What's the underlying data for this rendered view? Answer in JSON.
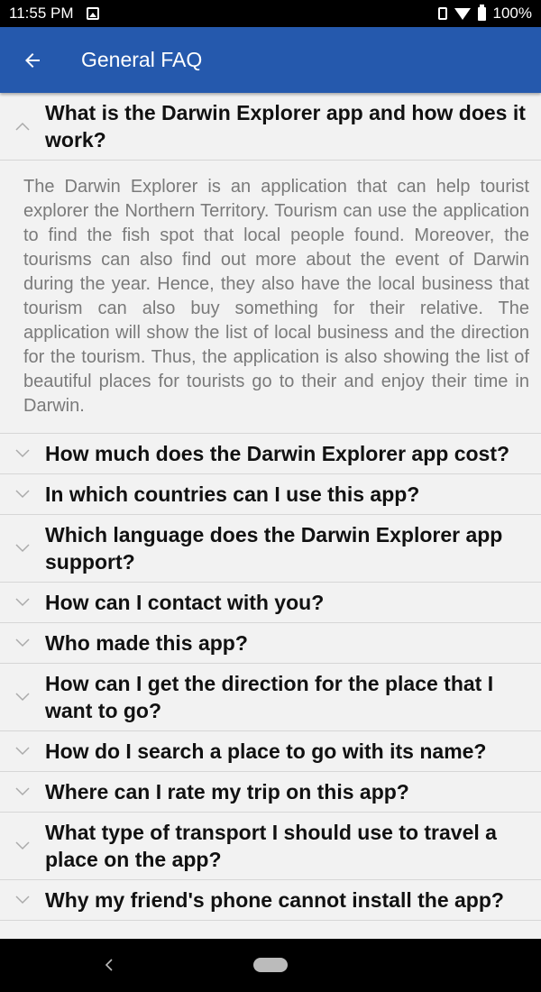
{
  "status_bar": {
    "time": "11:55 PM",
    "battery": "100%"
  },
  "header": {
    "title": "General FAQ"
  },
  "faq": [
    {
      "question": "What is the Darwin Explorer app and how does it work?",
      "expanded": true,
      "answer": "The Darwin Explorer is an application that can help tourist explorer the Northern Territory. Tourism can use the application to find the fish spot that local people found. Moreover, the tourisms can also find out more about the event of Darwin during the year. Hence, they also have the local business that tourism can also buy something for their relative. The application will show the list of local business and the direction for the tourism. Thus, the application is also showing the list of beautiful places for tourists go to their and enjoy their time in Darwin."
    },
    {
      "question": "How much does the Darwin Explorer app cost?",
      "expanded": false
    },
    {
      "question": "In which countries can I use this app?",
      "expanded": false
    },
    {
      "question": "Which language does the Darwin Explorer app support?",
      "expanded": false
    },
    {
      "question": "How can I contact with you?",
      "expanded": false
    },
    {
      "question": "Who made this app?",
      "expanded": false
    },
    {
      "question": "How can I get the direction for the place that I want to go?",
      "expanded": false
    },
    {
      "question": "How do I search a place to go with its name?",
      "expanded": false
    },
    {
      "question": "Where can I rate my trip on this app?",
      "expanded": false
    },
    {
      "question": "What type of transport I should use to travel a place on the app?",
      "expanded": false
    },
    {
      "question": "Why my friend's phone cannot install the app?",
      "expanded": false
    }
  ],
  "colors": {
    "app_bar": "#2559ad",
    "answer_text": "#7a7a7a",
    "chevron": "#aaaaaa"
  }
}
